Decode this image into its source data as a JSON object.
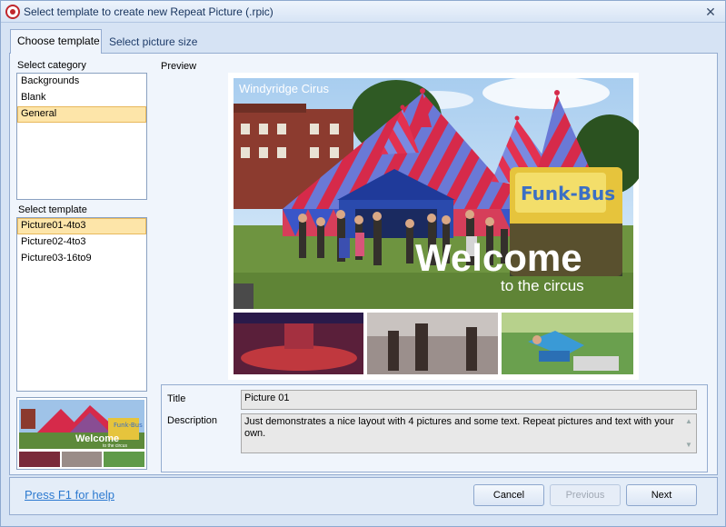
{
  "window": {
    "title": "Select template to create new Repeat Picture (.rpic)"
  },
  "tabs": [
    {
      "label": "Choose template",
      "active": true
    },
    {
      "label": "Select picture size",
      "active": false
    }
  ],
  "category": {
    "label": "Select category",
    "items": [
      "Backgrounds",
      "Blank",
      "General"
    ],
    "selected": 2
  },
  "template": {
    "label": "Select template",
    "items": [
      "Picture01-4to3",
      "Picture02-4to3",
      "Picture03-16to9"
    ],
    "selected": 0
  },
  "preview": {
    "label": "Preview",
    "overlay_caption": "Windyridge Cirus",
    "headline": "Welcome",
    "subline": "to the circus",
    "sign_text": "Funk-Bus"
  },
  "details": {
    "title_label": "Title",
    "title_value": "Picture 01",
    "description_label": "Description",
    "description_value": "Just demonstrates a nice layout with 4 pictures and some text.  Repeat pictures and text with your own."
  },
  "footer": {
    "help_link": "Press F1 for help",
    "cancel": "Cancel",
    "previous": "Previous",
    "next": "Next"
  },
  "colors": {
    "accent": "#2d7ad0",
    "selection": "#fde5a9",
    "tent_red": "#d62a4a",
    "tent_blue": "#3a56c8"
  }
}
